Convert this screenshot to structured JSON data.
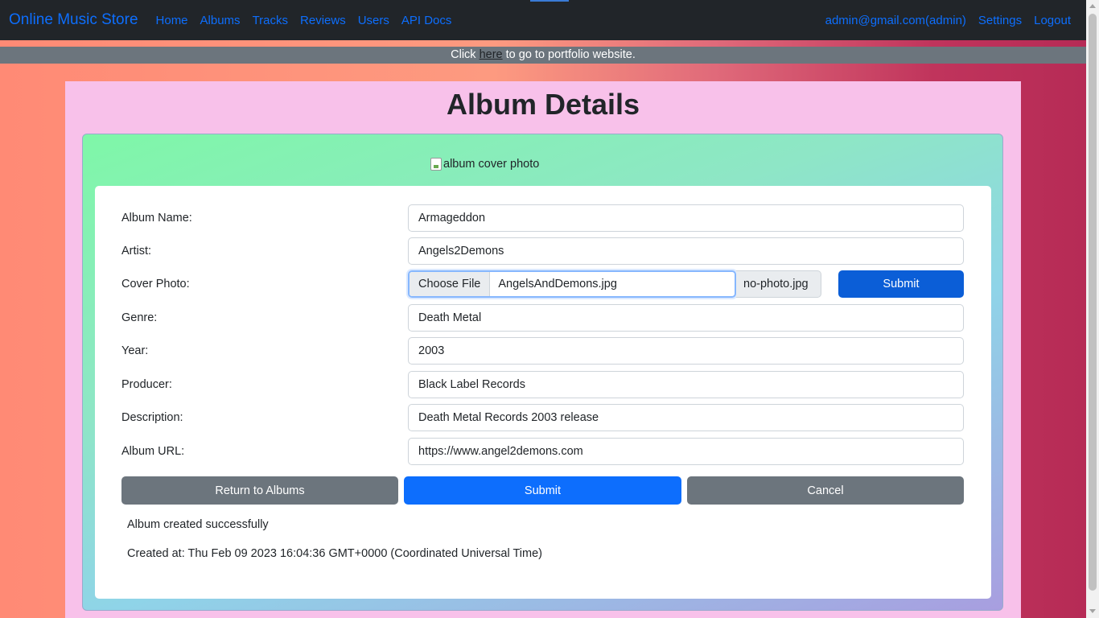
{
  "navbar": {
    "brand": "Online Music Store",
    "links": [
      "Home",
      "Albums",
      "Tracks",
      "Reviews",
      "Users",
      "API Docs"
    ],
    "user": "admin@gmail.com(admin)",
    "settings": "Settings",
    "logout": "Logout"
  },
  "banner": {
    "prefix": "Click ",
    "link": "here",
    "suffix": " to go to portfolio website."
  },
  "page": {
    "title": "Album Details",
    "cover_alt": "album cover photo"
  },
  "form": {
    "album_name": {
      "label": "Album Name:",
      "value": "Armageddon"
    },
    "artist": {
      "label": "Artist:",
      "value": "Angels2Demons"
    },
    "cover_photo": {
      "label": "Cover Photo:",
      "choose_file": "Choose File",
      "file_name": "AngelsAndDemons.jpg",
      "current": "no-photo.jpg",
      "submit": "Submit"
    },
    "genre": {
      "label": "Genre:",
      "value": "Death Metal"
    },
    "year": {
      "label": "Year:",
      "value": "2003"
    },
    "producer": {
      "label": "Producer:",
      "value": "Black Label Records"
    },
    "description": {
      "label": "Description:",
      "value": "Death Metal Records 2003 release"
    },
    "album_url": {
      "label": "Album URL:",
      "value": "https://www.angel2demons.com"
    }
  },
  "actions": {
    "return": "Return to Albums",
    "submit": "Submit",
    "cancel": "Cancel"
  },
  "status": {
    "message": "Album created successfully",
    "created_at": "Created at: Thu Feb 09 2023 16:04:36 GMT+0000 (Coordinated Universal Time)"
  }
}
